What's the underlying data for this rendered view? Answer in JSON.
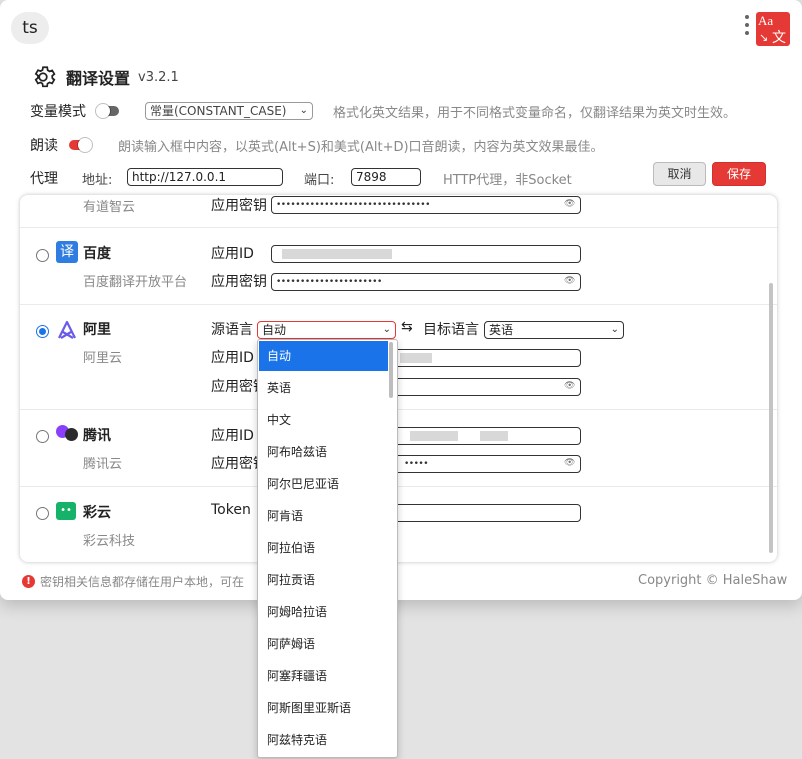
{
  "input_text": "ts",
  "logo": {
    "top": "Aa",
    "char": "文"
  },
  "settings": {
    "title": "翻译设置",
    "version": "v3.2.1",
    "variable_mode": {
      "label": "变量模式",
      "value": "常量(CONSTANT_CASE)",
      "hint": "格式化英文结果，用于不同格式变量命名，仅翻译结果为英文时生效。"
    },
    "read_aloud": {
      "label": "朗读",
      "hint": "朗读输入框中内容，以英式(Alt+S)和美式(Alt+D)口音朗读，内容为英文效果最佳。"
    },
    "proxy": {
      "label": "代理",
      "addr_label": "地址:",
      "addr_value": "http://127.0.0.1",
      "port_label": "端口:",
      "port_value": "7898",
      "hint": "HTTP代理，非Socket"
    },
    "cancel_label": "取消",
    "save_label": "保存"
  },
  "providers": [
    {
      "name": "有道智云",
      "fields": [
        {
          "label": "应用密钥",
          "value": "••••••••••••••••••••••••••••••••"
        }
      ]
    },
    {
      "name": "百度",
      "sub": "百度翻译开放平台",
      "icon": "译",
      "fields": [
        {
          "label": "应用ID",
          "value": ""
        },
        {
          "label": "应用密钥",
          "value": "••••••••••••••••••••••"
        }
      ]
    },
    {
      "name": "阿里",
      "sub": "阿里云",
      "selected": true,
      "source_label": "源语言",
      "source_value": "自动",
      "target_label": "目标语言",
      "target_value": "英语",
      "fields": [
        {
          "label": "应用ID"
        },
        {
          "label": "应用密钥"
        }
      ]
    },
    {
      "name": "腾讯",
      "sub": "腾讯云",
      "fields": [
        {
          "label": "应用ID",
          "value": ""
        },
        {
          "label": "应用密钥",
          "value": "•••••"
        }
      ]
    },
    {
      "name": "彩云",
      "sub": "彩云科技",
      "fields": [
        {
          "label": "Token",
          "value": ""
        }
      ]
    }
  ],
  "footer": {
    "info": "密钥相关信息都存储在用户本地，可在",
    "copyright": "Copyright © HaleShaw"
  },
  "dropdown": {
    "selected": "自动",
    "options": [
      "自动",
      "英语",
      "中文",
      "阿布哈兹语",
      "阿尔巴尼亚语",
      "阿肯语",
      "阿拉伯语",
      "阿拉贡语",
      "阿姆哈拉语",
      "阿萨姆语",
      "阿塞拜疆语",
      "阿斯图里亚斯语",
      "阿兹特克语"
    ]
  },
  "colors": {
    "accent": "#e53935",
    "select_blue": "#1a73e8"
  }
}
